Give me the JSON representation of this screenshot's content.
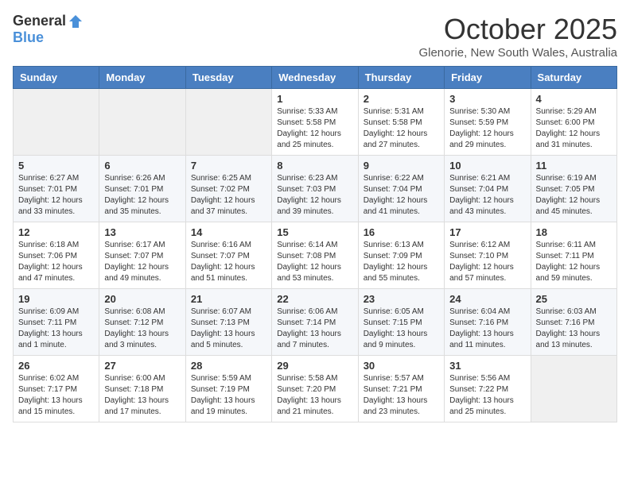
{
  "logo": {
    "general": "General",
    "blue": "Blue"
  },
  "title": "October 2025",
  "location": "Glenorie, New South Wales, Australia",
  "days_of_week": [
    "Sunday",
    "Monday",
    "Tuesday",
    "Wednesday",
    "Thursday",
    "Friday",
    "Saturday"
  ],
  "weeks": [
    [
      {
        "day": "",
        "info": ""
      },
      {
        "day": "",
        "info": ""
      },
      {
        "day": "",
        "info": ""
      },
      {
        "day": "1",
        "info": "Sunrise: 5:33 AM\nSunset: 5:58 PM\nDaylight: 12 hours\nand 25 minutes."
      },
      {
        "day": "2",
        "info": "Sunrise: 5:31 AM\nSunset: 5:58 PM\nDaylight: 12 hours\nand 27 minutes."
      },
      {
        "day": "3",
        "info": "Sunrise: 5:30 AM\nSunset: 5:59 PM\nDaylight: 12 hours\nand 29 minutes."
      },
      {
        "day": "4",
        "info": "Sunrise: 5:29 AM\nSunset: 6:00 PM\nDaylight: 12 hours\nand 31 minutes."
      }
    ],
    [
      {
        "day": "5",
        "info": "Sunrise: 6:27 AM\nSunset: 7:01 PM\nDaylight: 12 hours\nand 33 minutes."
      },
      {
        "day": "6",
        "info": "Sunrise: 6:26 AM\nSunset: 7:01 PM\nDaylight: 12 hours\nand 35 minutes."
      },
      {
        "day": "7",
        "info": "Sunrise: 6:25 AM\nSunset: 7:02 PM\nDaylight: 12 hours\nand 37 minutes."
      },
      {
        "day": "8",
        "info": "Sunrise: 6:23 AM\nSunset: 7:03 PM\nDaylight: 12 hours\nand 39 minutes."
      },
      {
        "day": "9",
        "info": "Sunrise: 6:22 AM\nSunset: 7:04 PM\nDaylight: 12 hours\nand 41 minutes."
      },
      {
        "day": "10",
        "info": "Sunrise: 6:21 AM\nSunset: 7:04 PM\nDaylight: 12 hours\nand 43 minutes."
      },
      {
        "day": "11",
        "info": "Sunrise: 6:19 AM\nSunset: 7:05 PM\nDaylight: 12 hours\nand 45 minutes."
      }
    ],
    [
      {
        "day": "12",
        "info": "Sunrise: 6:18 AM\nSunset: 7:06 PM\nDaylight: 12 hours\nand 47 minutes."
      },
      {
        "day": "13",
        "info": "Sunrise: 6:17 AM\nSunset: 7:07 PM\nDaylight: 12 hours\nand 49 minutes."
      },
      {
        "day": "14",
        "info": "Sunrise: 6:16 AM\nSunset: 7:07 PM\nDaylight: 12 hours\nand 51 minutes."
      },
      {
        "day": "15",
        "info": "Sunrise: 6:14 AM\nSunset: 7:08 PM\nDaylight: 12 hours\nand 53 minutes."
      },
      {
        "day": "16",
        "info": "Sunrise: 6:13 AM\nSunset: 7:09 PM\nDaylight: 12 hours\nand 55 minutes."
      },
      {
        "day": "17",
        "info": "Sunrise: 6:12 AM\nSunset: 7:10 PM\nDaylight: 12 hours\nand 57 minutes."
      },
      {
        "day": "18",
        "info": "Sunrise: 6:11 AM\nSunset: 7:11 PM\nDaylight: 12 hours\nand 59 minutes."
      }
    ],
    [
      {
        "day": "19",
        "info": "Sunrise: 6:09 AM\nSunset: 7:11 PM\nDaylight: 13 hours\nand 1 minute."
      },
      {
        "day": "20",
        "info": "Sunrise: 6:08 AM\nSunset: 7:12 PM\nDaylight: 13 hours\nand 3 minutes."
      },
      {
        "day": "21",
        "info": "Sunrise: 6:07 AM\nSunset: 7:13 PM\nDaylight: 13 hours\nand 5 minutes."
      },
      {
        "day": "22",
        "info": "Sunrise: 6:06 AM\nSunset: 7:14 PM\nDaylight: 13 hours\nand 7 minutes."
      },
      {
        "day": "23",
        "info": "Sunrise: 6:05 AM\nSunset: 7:15 PM\nDaylight: 13 hours\nand 9 minutes."
      },
      {
        "day": "24",
        "info": "Sunrise: 6:04 AM\nSunset: 7:16 PM\nDaylight: 13 hours\nand 11 minutes."
      },
      {
        "day": "25",
        "info": "Sunrise: 6:03 AM\nSunset: 7:16 PM\nDaylight: 13 hours\nand 13 minutes."
      }
    ],
    [
      {
        "day": "26",
        "info": "Sunrise: 6:02 AM\nSunset: 7:17 PM\nDaylight: 13 hours\nand 15 minutes."
      },
      {
        "day": "27",
        "info": "Sunrise: 6:00 AM\nSunset: 7:18 PM\nDaylight: 13 hours\nand 17 minutes."
      },
      {
        "day": "28",
        "info": "Sunrise: 5:59 AM\nSunset: 7:19 PM\nDaylight: 13 hours\nand 19 minutes."
      },
      {
        "day": "29",
        "info": "Sunrise: 5:58 AM\nSunset: 7:20 PM\nDaylight: 13 hours\nand 21 minutes."
      },
      {
        "day": "30",
        "info": "Sunrise: 5:57 AM\nSunset: 7:21 PM\nDaylight: 13 hours\nand 23 minutes."
      },
      {
        "day": "31",
        "info": "Sunrise: 5:56 AM\nSunset: 7:22 PM\nDaylight: 13 hours\nand 25 minutes."
      },
      {
        "day": "",
        "info": ""
      }
    ]
  ]
}
